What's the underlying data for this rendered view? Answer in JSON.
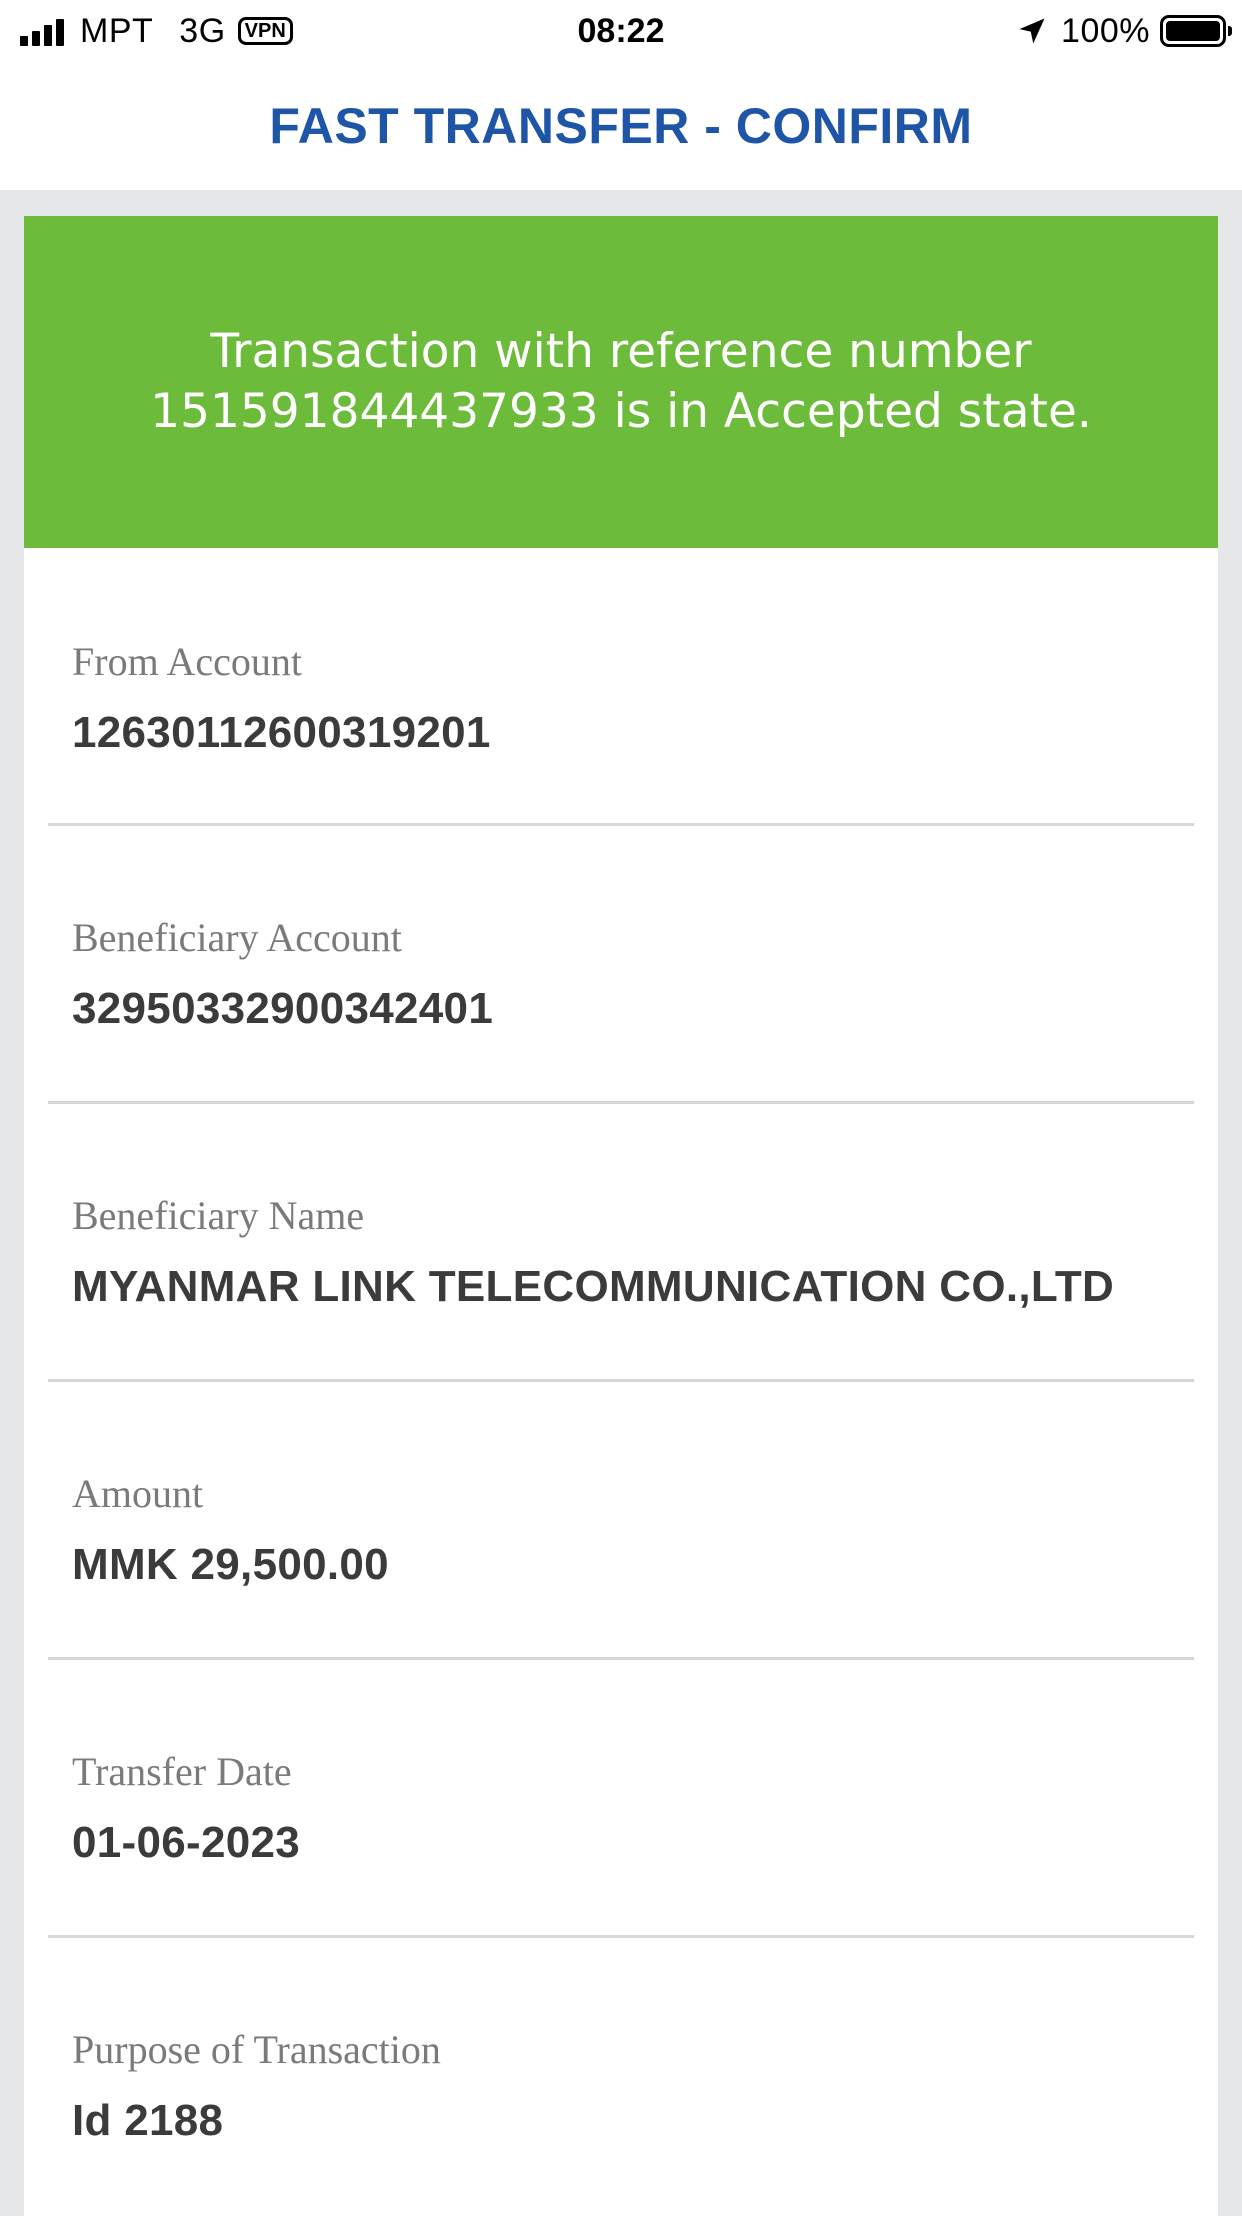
{
  "status_bar": {
    "carrier": "MPT",
    "network": "3G",
    "vpn": "VPN",
    "time": "08:22",
    "battery": "100%",
    "icons": [
      "signal-icon",
      "vpn-icon",
      "location-arrow-icon",
      "battery-icon"
    ]
  },
  "header": {
    "title": "FAST TRANSFER - CONFIRM",
    "title_color": "#1f55a6"
  },
  "banner": {
    "message": "Transaction with reference  number 151591844437933 is in Accepted state.",
    "background": "#6dbb3a"
  },
  "fields": [
    {
      "label": "From Account",
      "value": "12630112600319201"
    },
    {
      "label": "Beneficiary Account",
      "value": "32950332900342401"
    },
    {
      "label": "Beneficiary Name",
      "value": "MYANMAR LINK TELECOMMUNICATION CO.,LTD"
    },
    {
      "label": "Amount",
      "value": "MMK 29,500.00"
    },
    {
      "label": "Transfer Date",
      "value": "01-06-2023"
    },
    {
      "label": "Purpose of Transaction",
      "value": "Id 2188"
    }
  ]
}
